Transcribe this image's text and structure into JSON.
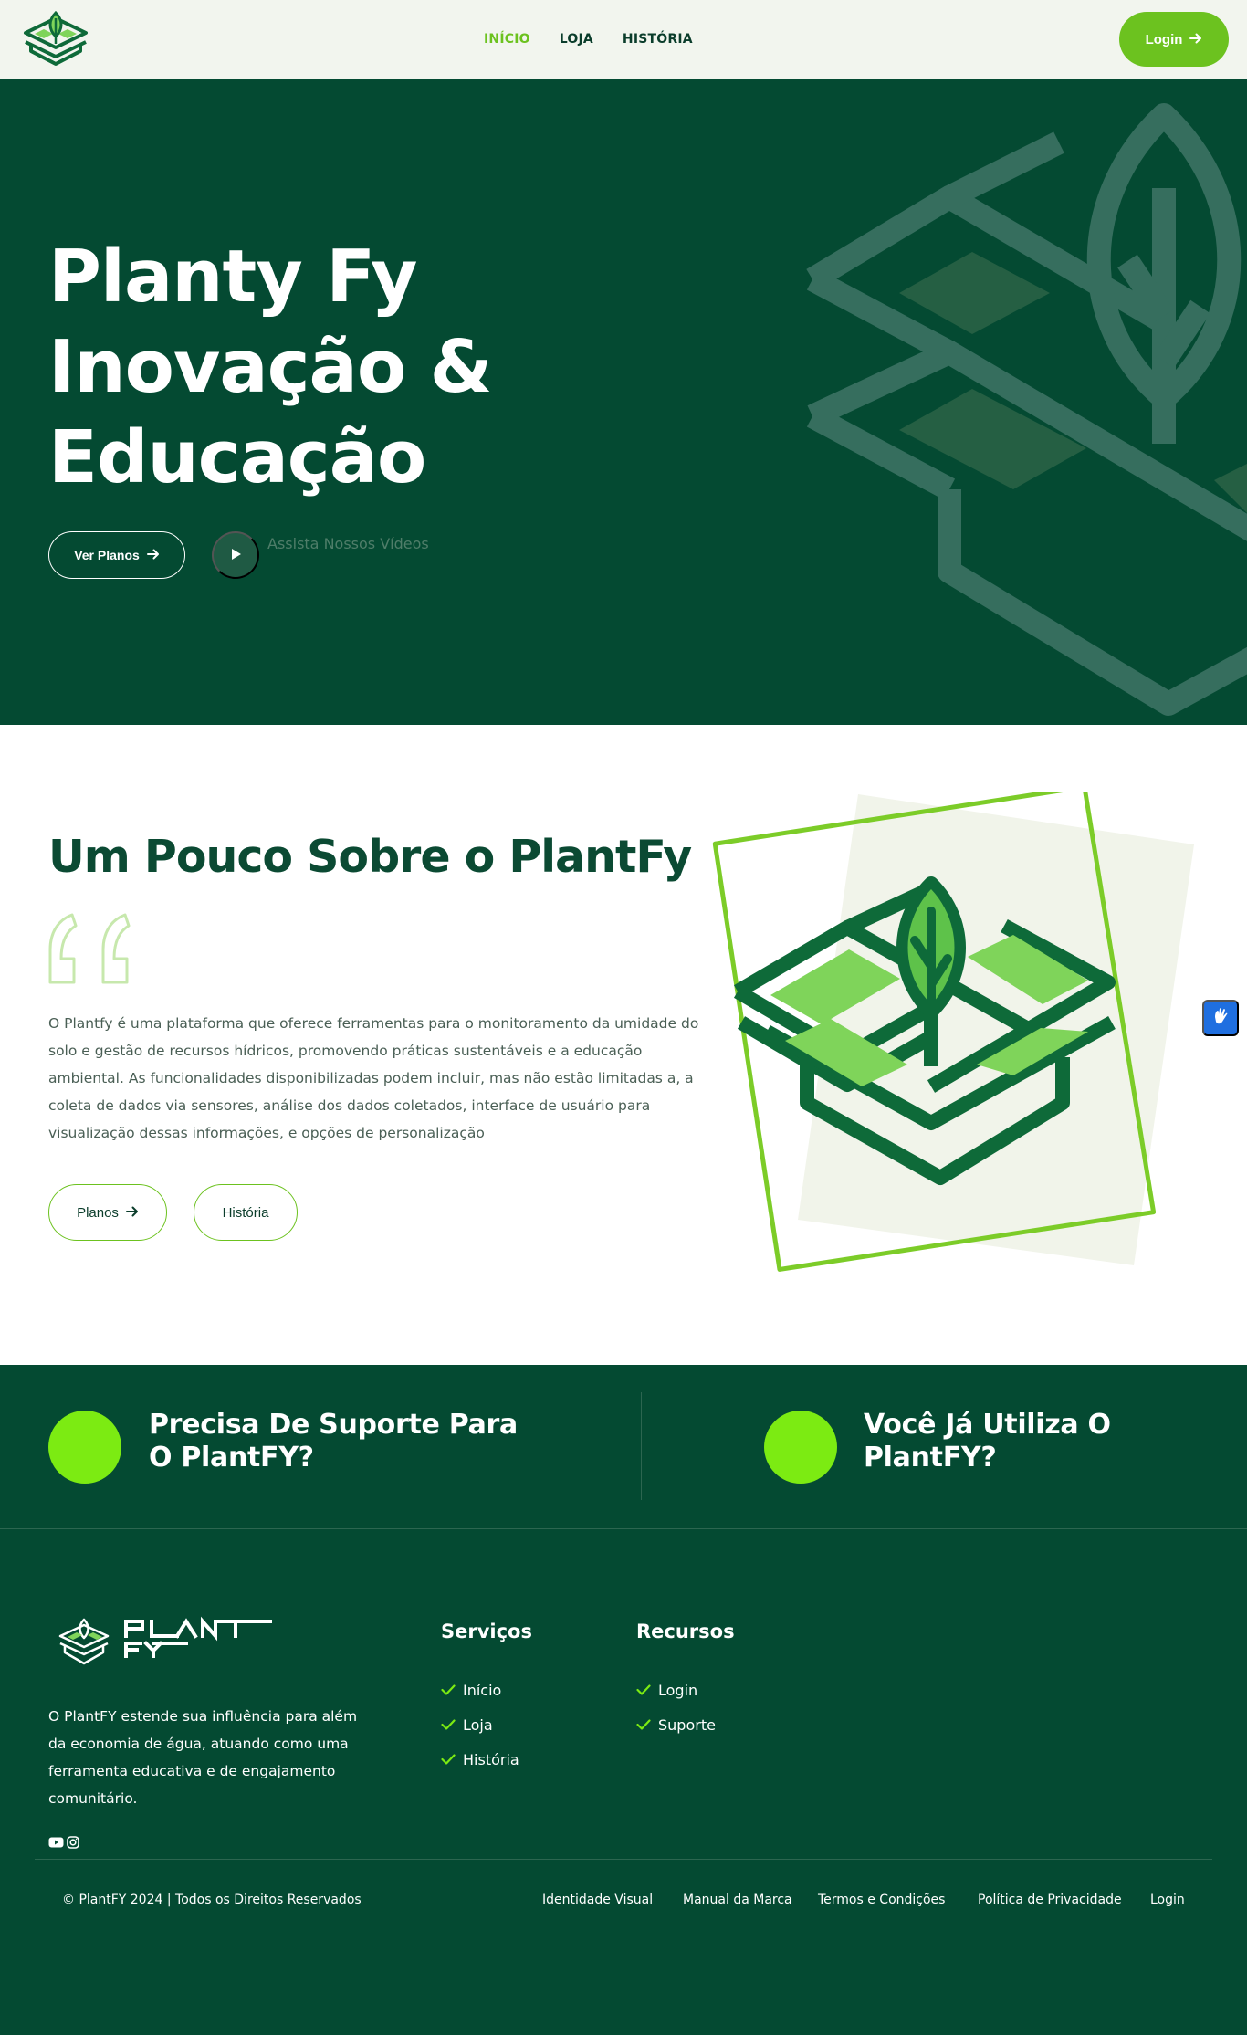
{
  "nav": {
    "links": [
      {
        "label": "INÍCIO",
        "active": true
      },
      {
        "label": "LOJA",
        "active": false
      },
      {
        "label": "HISTÓRIA",
        "active": false
      }
    ],
    "login_label": "Login"
  },
  "hero": {
    "title_lines": [
      "Planty Fy",
      "Inovação &",
      "Educação"
    ],
    "cta_label": "Ver Planos",
    "video_label": "Assista Nossos Vídeos"
  },
  "about": {
    "title": "Um Pouco Sobre o PlantFy",
    "text": "O Plantfy é uma plataforma que oferece ferramentas para o monitoramento da umidade do solo e gestão de recursos hídricos, promovendo práticas sustentáveis e a educação ambiental. As funcionalidades disponibilizadas podem incluir, mas não estão limitadas a, a coleta de dados via sensores, análise dos dados coletados, interface de usuário para visualização dessas informações, e opções de personalização",
    "buttons": {
      "planos": "Planos",
      "historia": "História"
    }
  },
  "support": {
    "left_line1": "Precisa De Suporte Para",
    "left_line2": "O PlantFY?",
    "right": "Você Já Utiliza O PlantFY?"
  },
  "footer": {
    "about": "O PlantFY estende sua influência para além da economia de água, atuando como uma ferramenta educativa e de engajamento comunitário.",
    "services_title": "Serviços",
    "services": [
      "Início",
      "Loja",
      "História"
    ],
    "resources_title": "Recursos",
    "resources": [
      "Login",
      "Suporte"
    ],
    "copyright": "© PlantFY 2024 | Todos os Direitos Reservados",
    "legal_links": [
      "Identidade Visual",
      "Manual da Marca",
      "Termos e Condições",
      "Política de Privacidade",
      "Login"
    ]
  },
  "colors": {
    "dark_green": "#044a32",
    "accent_green": "#6cc21f",
    "lime": "#7ceb12",
    "nav_bg": "#f2f5ee"
  },
  "icons": [
    "logo-icon",
    "arrow-right-icon",
    "play-icon",
    "quote-icon",
    "check-icon",
    "youtube-icon",
    "instagram-icon",
    "accessibility-hand-icon"
  ]
}
